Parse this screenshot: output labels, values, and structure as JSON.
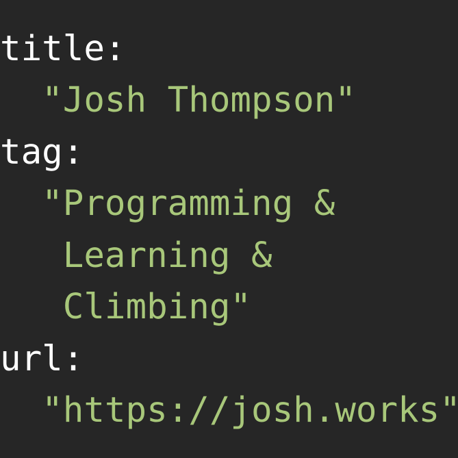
{
  "colors": {
    "background": "#262626",
    "key": "#ffffff",
    "string": "#a8c77a"
  },
  "lines": [
    {
      "text": "title:",
      "kind": "key"
    },
    {
      "text": "  \"Josh Thompson\"",
      "kind": "string"
    },
    {
      "text": "tag:",
      "kind": "key"
    },
    {
      "text": "  \"Programming &",
      "kind": "string"
    },
    {
      "text": "   Learning &",
      "kind": "string"
    },
    {
      "text": "   Climbing\"",
      "kind": "string"
    },
    {
      "text": "url:",
      "kind": "key"
    },
    {
      "text": "  \"https://josh.works\"",
      "kind": "string"
    }
  ]
}
